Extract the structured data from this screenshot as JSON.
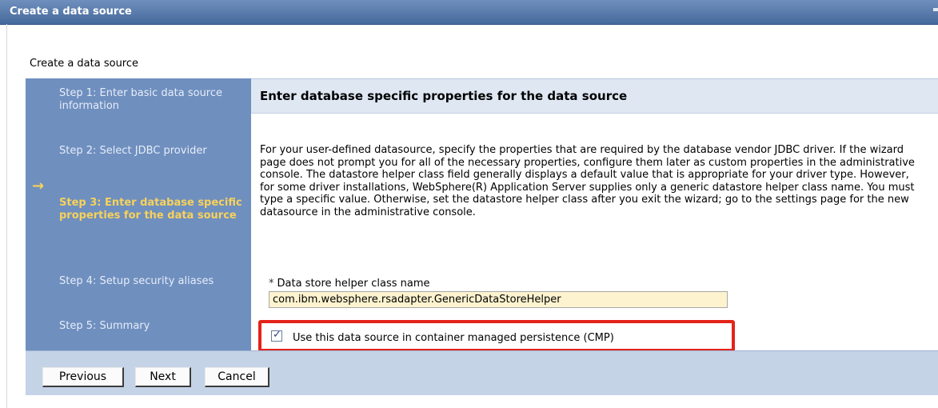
{
  "window": {
    "title": "Create a data source"
  },
  "page": {
    "heading": "Create a data source"
  },
  "steps": [
    {
      "label": "Step 1: Enter basic data source information",
      "current": false
    },
    {
      "label": "Step 2: Select JDBC provider",
      "current": false
    },
    {
      "label": "Step 3: Enter database specific properties for the data source",
      "current": true
    },
    {
      "label": "Step 4: Setup security aliases",
      "current": false
    },
    {
      "label": "Step 5: Summary",
      "current": false
    }
  ],
  "current_step_indicator": "→",
  "content": {
    "title": "Enter database specific properties for the data source",
    "description": "For your user-defined datasource, specify the properties that are required by the database vendor JDBC driver. If the wizard page does not prompt you for all of the necessary properties, configure them later as custom properties in the administrative console. The datastore helper class field generally displays a default value that is appropriate for your driver type. However, for some driver installations, WebSphere(R) Application Server supplies only a generic datastore helper class name. You must type a specific value. Otherwise, set the datastore helper class after you exit the wizard; go to the settings page for the new datasource in the administrative console.",
    "required_marker": "*",
    "helper_field": {
      "label": "Data store helper class name",
      "value": "com.ibm.websphere.rsadapter.GenericDataStoreHelper"
    },
    "cmp_checkbox": {
      "label": "Use this data source in container managed persistence (CMP)",
      "checked": true,
      "check_glyph": "✓"
    }
  },
  "buttons": {
    "previous": "Previous",
    "next": "Next",
    "cancel": "Cancel"
  },
  "colors": {
    "title_bar": "#46699c",
    "steps_panel": "#6f8fbf",
    "current_step": "#f7d25a",
    "content_header": "#dfe7f3",
    "input_background": "#fdf3cf",
    "highlight_border": "#e32319",
    "button_bar": "#c5d3e7"
  }
}
